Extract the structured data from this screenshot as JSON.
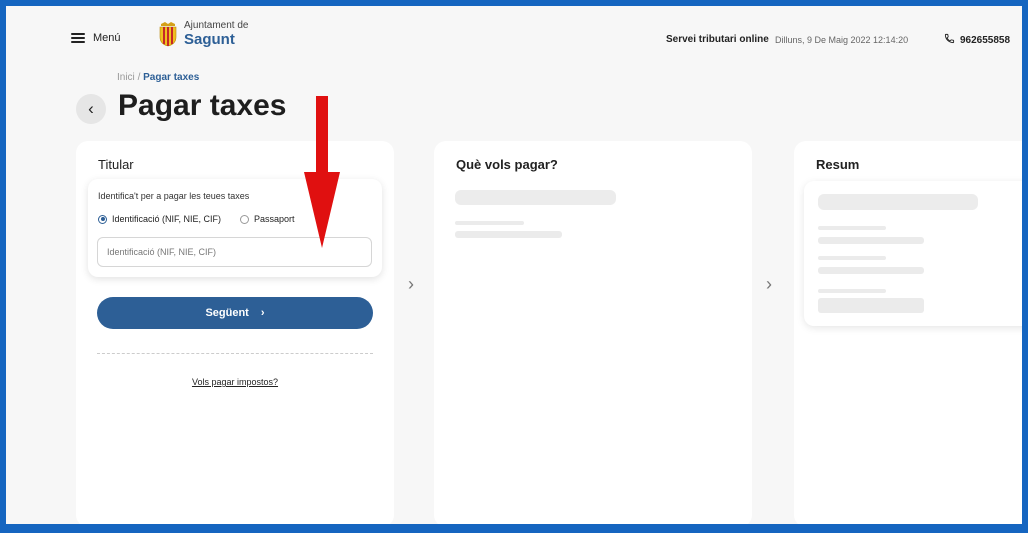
{
  "header": {
    "menu_label": "Menú",
    "logo_sub": "Ajuntament de",
    "logo_main": "Sagunt",
    "service": "Servei tributari online",
    "datetime": "Dilluns, 9 De Maig 2022 12:14:20",
    "phone": "962655858"
  },
  "breadcrumb": {
    "home": "Inici",
    "separator": " / ",
    "current": "Pagar taxes"
  },
  "page_title": "Pagar taxes",
  "panel_titular": {
    "title": "Titular",
    "prompt": "Identifica't per a pagar les teues taxes",
    "radio_id_label": "Identificació (NIF, NIE, CIF)",
    "radio_passport_label": "Passaport",
    "selected": "Identificació (NIF, NIE, CIF)",
    "input_placeholder": "Identificació (NIF, NIE, CIF)",
    "input_value": "",
    "next_button": "Següent",
    "link": "Vols pagar impostos?"
  },
  "panel_pay": {
    "title": "Què vols pagar?"
  },
  "panel_summary": {
    "title": "Resum"
  },
  "colors": {
    "frame": "#1565c0",
    "brand": "#2d5f96",
    "annotation_arrow": "#e01010"
  },
  "icons": {
    "menu": "hamburger-icon",
    "phone": "phone-icon",
    "back": "chevron-left-icon",
    "next": "chevron-right-icon",
    "annotation": "red-arrow-icon"
  }
}
